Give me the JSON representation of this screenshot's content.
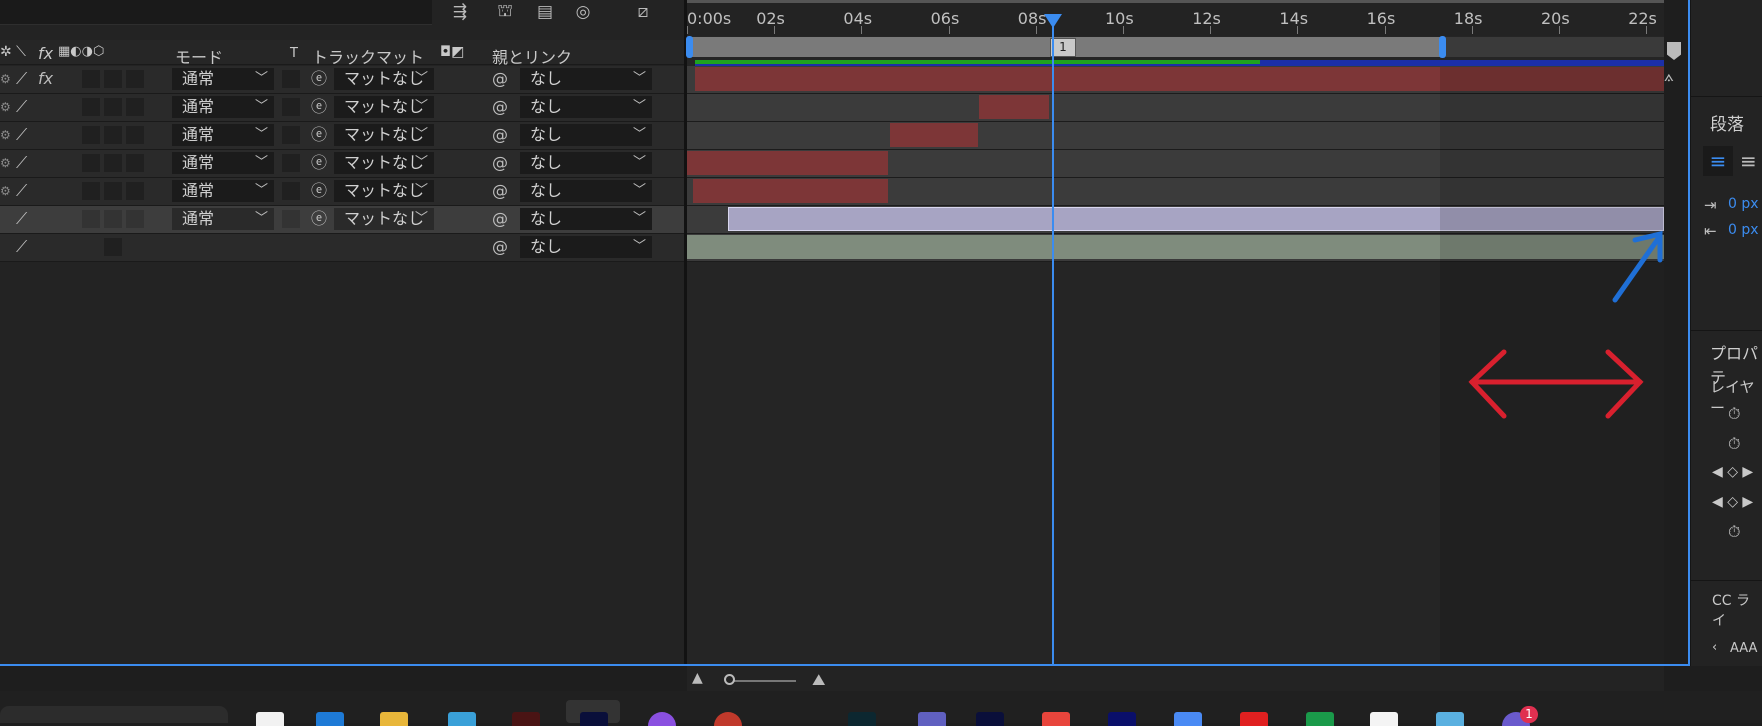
{
  "columns": {
    "mode": "モード",
    "trackmatte": "トラックマット",
    "t_label": "T",
    "parent_link": "親とリンク",
    "fx": "fx"
  },
  "layers": [
    {
      "mode": "通常",
      "matte": "マットなし",
      "parent": "なし",
      "fx": "fx",
      "bar_color": "#7d3637"
    },
    {
      "mode": "通常",
      "matte": "マットなし",
      "parent": "なし",
      "fx": "",
      "bar_color": "#7d3637"
    },
    {
      "mode": "通常",
      "matte": "マットなし",
      "parent": "なし",
      "fx": "",
      "bar_color": "#7d3637"
    },
    {
      "mode": "通常",
      "matte": "マットなし",
      "parent": "なし",
      "fx": "",
      "bar_color": "#7d3637"
    },
    {
      "mode": "通常",
      "matte": "マットなし",
      "parent": "なし",
      "fx": "",
      "bar_color": "#7d3637"
    },
    {
      "mode": "通常",
      "matte": "マットなし",
      "parent": "なし",
      "fx": "",
      "bar_color": "#a7a4c3"
    },
    {
      "mode": "",
      "matte": "",
      "parent": "なし",
      "fx": "",
      "bar_color": "#7f8c7d"
    }
  ],
  "ruler": {
    "ticks": [
      "0:00s",
      "02s",
      "04s",
      "06s",
      "08s",
      "10s",
      "12s",
      "14s",
      "16s",
      "18s",
      "20s",
      "22s"
    ],
    "marker_label": "1"
  },
  "right_panel": {
    "paragraph_title": "段落",
    "indent_left_value": "0 px",
    "indent_right_value": "0 px",
    "properties_title": "プロパテ",
    "layer_label": "レイヤー",
    "cc_label": "CC ライ",
    "aaa_label": "AAA"
  },
  "colors": {
    "accent": "#3b8cf0",
    "layer_red": "#7d3637",
    "layer_lavender": "#a7a4c3",
    "layer_green": "#7f8c7d",
    "annotation_red": "#d9202e",
    "annotation_blue": "#1f6fd6"
  },
  "taskbar": {
    "badge_count": "1"
  }
}
